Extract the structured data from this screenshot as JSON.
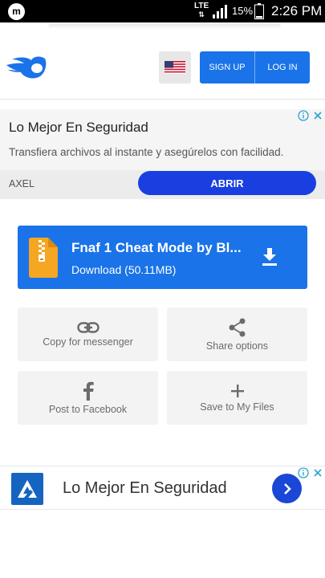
{
  "statusbar": {
    "app_glyph": "m",
    "network": "LTE",
    "network_arrows": "⇅",
    "battery_pct": "15%",
    "time": "2:26 PM"
  },
  "header": {
    "logo_icon": "mediafire-flame-icon",
    "flag_icon": "us-flag-icon",
    "signup_label": "SIGN UP",
    "login_label": "LOG IN"
  },
  "ad_top": {
    "title": "Lo Mejor En Seguridad",
    "text": "Transfiera archivos al instante y asegúrelos con facilidad.",
    "brand": "AXEL",
    "cta": "ABRIR"
  },
  "download": {
    "title": "Fnaf 1 Cheat Mode by Bl...",
    "subtitle": "Download (50.11MB)"
  },
  "actions": [
    {
      "label": "Copy for messenger",
      "icon": "link-icon"
    },
    {
      "label": "Share options",
      "icon": "share-icon"
    },
    {
      "label": "Post to Facebook",
      "icon": "facebook-icon"
    },
    {
      "label": "Save to My Files",
      "icon": "plus-icon"
    }
  ],
  "ad_bottom": {
    "title": "Lo Mejor En Seguridad"
  },
  "colors": {
    "accent": "#1a73e8",
    "cta": "#1a3fe0",
    "tile_bg": "#f3f3f3"
  }
}
